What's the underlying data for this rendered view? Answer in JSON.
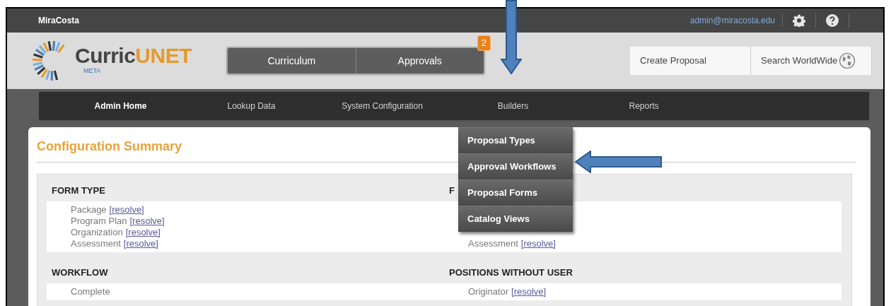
{
  "top_bar": {
    "site": "MiraCosta",
    "user": "admin@miracosta.edu"
  },
  "logo": {
    "wordmark": [
      "Curric",
      "UNET"
    ],
    "tagline": "META"
  },
  "main_tabs": [
    {
      "label": "Curriculum"
    },
    {
      "label": "Approvals",
      "badge": "2"
    }
  ],
  "actions": [
    {
      "label": "Create Proposal"
    },
    {
      "label": "Search WorldWide"
    }
  ],
  "nav": [
    {
      "label": "Admin Home",
      "selected": true
    },
    {
      "label": "Lookup Data",
      "selected": false
    },
    {
      "label": "System Configuration",
      "selected": false
    },
    {
      "label": "Builders",
      "selected": false
    },
    {
      "label": "Reports",
      "selected": false
    }
  ],
  "dropdown": {
    "items": [
      "Proposal Types",
      "Approval Workflows",
      "Proposal Forms",
      "Catalog Views"
    ]
  },
  "page": {
    "title": "Configuration Summary",
    "rows": [
      [
        {
          "heading": "FORM TYPE",
          "items": [
            {
              "name": "Package",
              "link": "[resolve]"
            },
            {
              "name": "Program Plan",
              "link": "[resolve]"
            },
            {
              "name": "Organization",
              "link": "[resolve]"
            },
            {
              "name": "Assessment",
              "link": "[resolve]"
            }
          ]
        },
        {
          "heading": "F",
          "items": [
            {
              "name": "Assessment",
              "link": "[resolve]"
            }
          ]
        }
      ],
      [
        {
          "heading": "WORKFLOW",
          "items": [
            {
              "name": "Complete"
            }
          ]
        },
        {
          "heading": "POSITIONS WITHOUT USER",
          "items": [
            {
              "name": "Originator",
              "link": "[resolve]"
            }
          ]
        }
      ]
    ]
  }
}
